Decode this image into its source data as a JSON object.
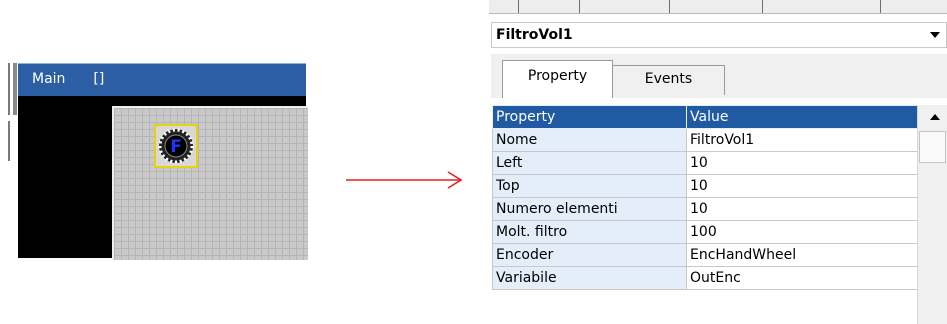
{
  "designer": {
    "window_title": "Main",
    "window_title_extra": "[]",
    "widget_label": "F"
  },
  "property_panel": {
    "object_selector": {
      "value": "FiltroVol1"
    },
    "tabs": [
      {
        "label": "Property",
        "active": true
      },
      {
        "label": "Events",
        "active": false
      }
    ],
    "grid": {
      "header": {
        "name": "Property",
        "value": "Value"
      },
      "rows": [
        {
          "name": "Nome",
          "value": "FiltroVol1"
        },
        {
          "name": "Left",
          "value": "10"
        },
        {
          "name": "Top",
          "value": "10"
        },
        {
          "name": "Numero elementi",
          "value": "10"
        },
        {
          "name": "Molt. filtro",
          "value": "100"
        },
        {
          "name": "Encoder",
          "value": "EncHandWheel"
        },
        {
          "name": "Variabile",
          "value": "OutEnc"
        }
      ]
    }
  },
  "colors": {
    "titlebar": "#2b5ea5",
    "grid_header": "#1f5aa3",
    "property_name_bg": "#e3eefa",
    "arrow": "#e02020",
    "selection_border": "#e6d400",
    "widget_letter": "#2233ff"
  }
}
